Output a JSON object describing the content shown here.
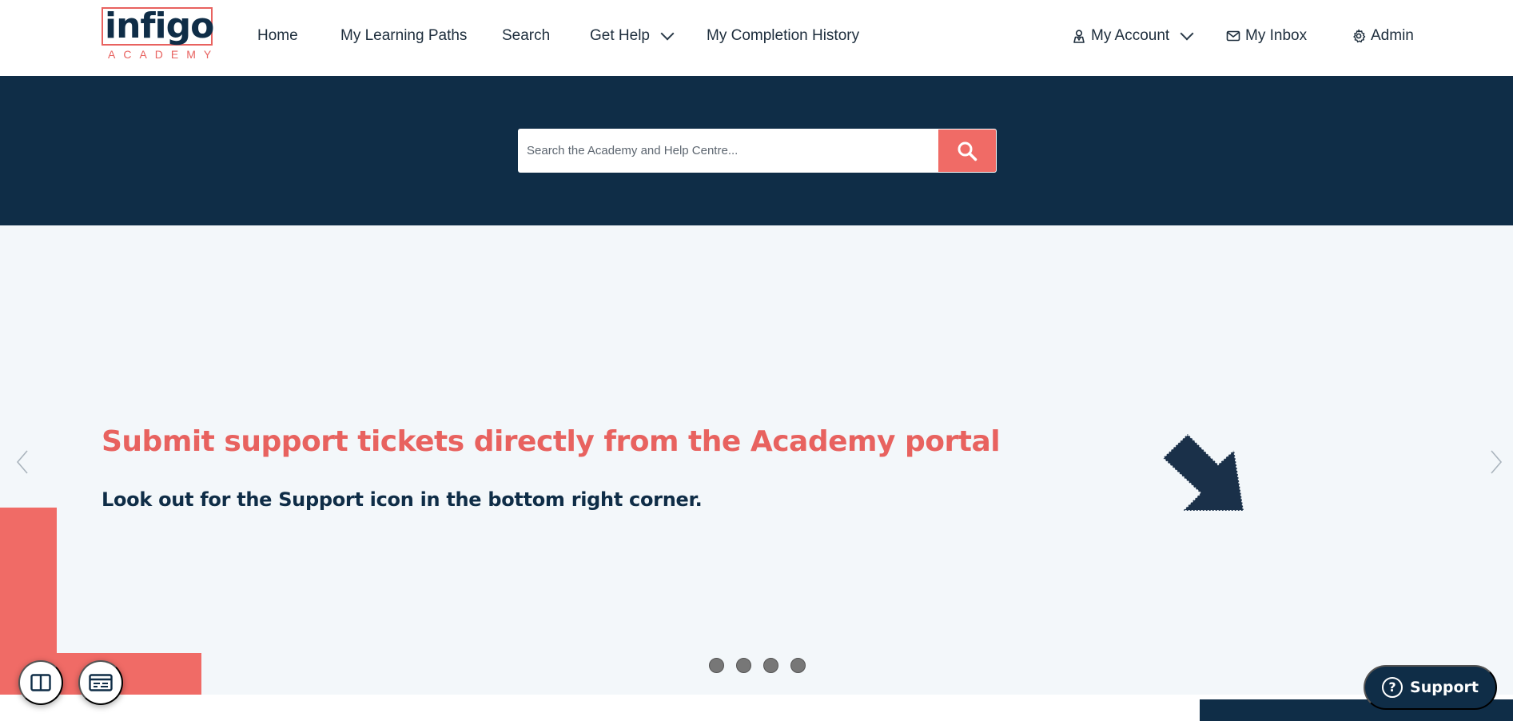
{
  "logo": {
    "word": "infigo",
    "subtitle": "ACADEMY"
  },
  "nav": {
    "home": "Home",
    "learning_paths": "My Learning Paths",
    "search": "Search",
    "get_help": "Get Help",
    "completion_history": "My Completion History",
    "my_account": "My Account",
    "my_inbox": "My Inbox",
    "admin": "Admin"
  },
  "search": {
    "placeholder": "Search the Academy and Help Centre...",
    "value": ""
  },
  "hero": {
    "title": "Submit support tickets directly from the Academy portal",
    "subtitle": "Look out for the Support icon in the bottom right corner.",
    "slide_count": 4
  },
  "support": {
    "label": "Support",
    "glyph": "?"
  },
  "icons": [
    "search-icon",
    "account-icon",
    "mail-icon",
    "gear-icon",
    "chevron-down-icon",
    "chevron-left-icon",
    "chevron-right-icon",
    "columns-icon",
    "card-icon",
    "question-icon",
    "arrow-down-right-icon"
  ],
  "colors": {
    "navy": "#0f2d47",
    "coral": "#f06b66",
    "hero_bg": "#f3f7fa"
  }
}
